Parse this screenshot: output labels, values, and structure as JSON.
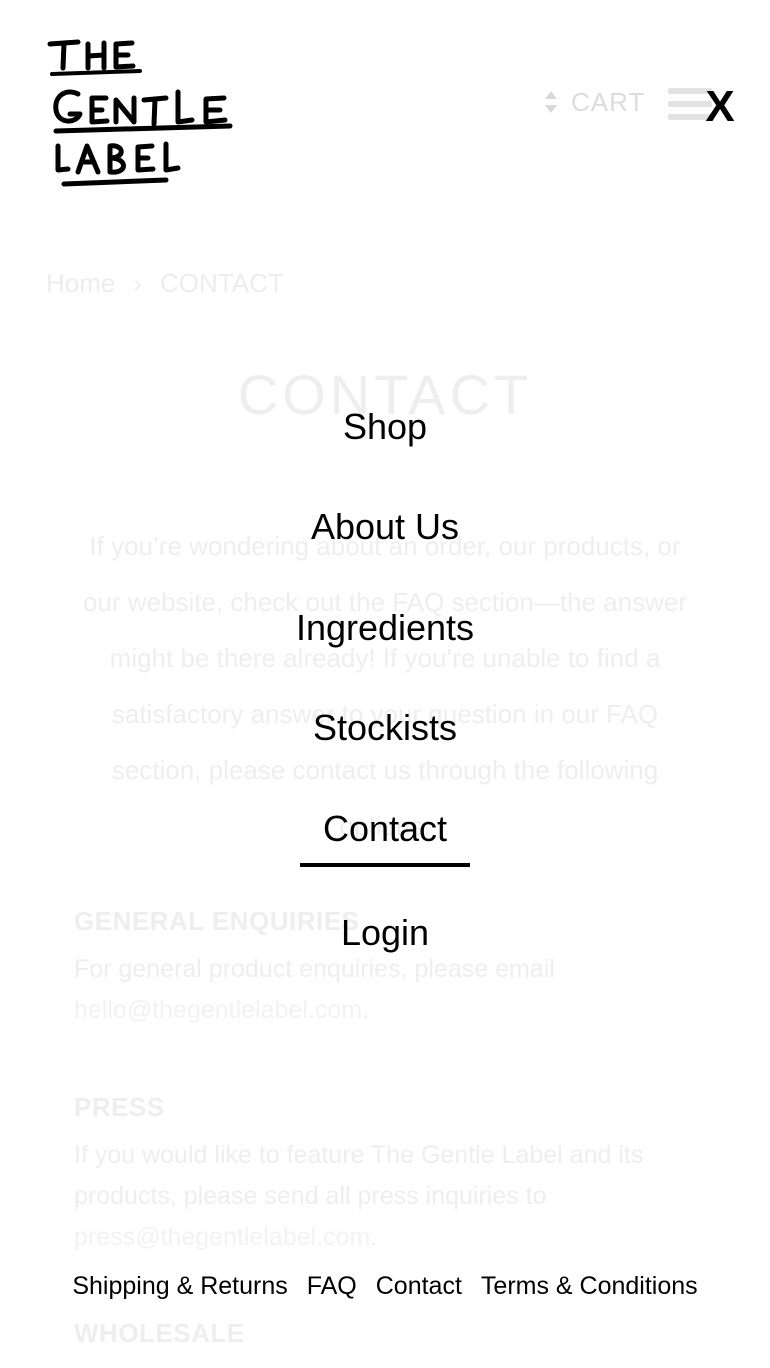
{
  "brand": {
    "logo_lines": [
      "THE",
      "GENTLE",
      "LABEL"
    ]
  },
  "header": {
    "cart_label": "CART",
    "close_label": "X"
  },
  "page": {
    "breadcrumb": {
      "home": "Home",
      "separator": "›",
      "current": "CONTACT"
    },
    "title": "CONTACT",
    "intro": "If you’re wondering about an order, our products, or our website, check out the FAQ section—the answer might be there already! If you’re unable to find a satisfactory answer to your question in our FAQ section, please contact us through the following options:",
    "sections": {
      "general": {
        "heading": "GENERAL ENQUIRIES",
        "text": "For general product enquiries, please email",
        "email": "hello@thegentlelabel.com",
        "suffix": "."
      },
      "press": {
        "heading": "PRESS",
        "text": "If you would like to feature The Gentle Label and its products, please send all press inquiries to",
        "email": "press@thegentlelabel.com",
        "suffix": "."
      },
      "wholesale": {
        "heading": "WHOLESALE"
      }
    }
  },
  "menu": {
    "items": [
      {
        "label": "Shop"
      },
      {
        "label": "About Us"
      },
      {
        "label": "Ingredients"
      },
      {
        "label": "Stockists"
      },
      {
        "label": "Contact",
        "active": true
      },
      {
        "label": "Login"
      }
    ],
    "footer_links": [
      "Shipping & Returns",
      "FAQ",
      "Contact",
      "Terms & Conditions"
    ]
  },
  "colors": {
    "text": "#000000",
    "faded_text": "#eeeeee",
    "background": "#ffffff"
  }
}
